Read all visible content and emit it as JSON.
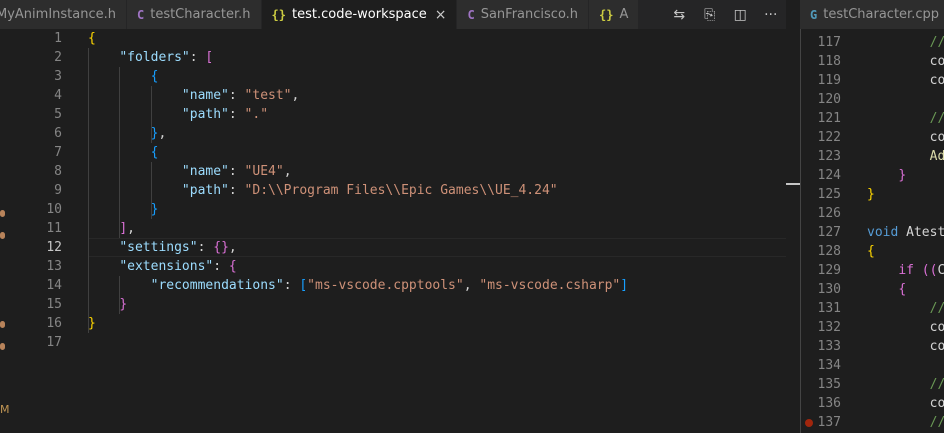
{
  "tabs_left": [
    {
      "icon": "c-header-icon",
      "glyph": "",
      "label": "MyAnimInstance.h",
      "active": false
    },
    {
      "icon": "c-header-icon",
      "glyph": "C",
      "label": "testCharacter.h",
      "active": false
    },
    {
      "icon": "json-icon",
      "glyph": "{}",
      "label": "test.code-workspace",
      "active": true
    },
    {
      "icon": "c-header-icon",
      "glyph": "C",
      "label": "SanFrancisco.h",
      "active": false
    },
    {
      "icon": "json-icon",
      "glyph": "{}",
      "label": "A",
      "active": false
    }
  ],
  "toolbar": {
    "compare_glyph": "⇆",
    "open_preview_glyph": "⎘",
    "split_glyph": "◫",
    "more_glyph": "···"
  },
  "tabs_right": [
    {
      "icon": "cpp-icon",
      "glyph": "G",
      "label": "testCharacter.cpp",
      "active": false
    }
  ],
  "left_editor": {
    "current_line": 12,
    "lines": [
      {
        "n": "1",
        "t": [
          [
            "br",
            "{"
          ]
        ]
      },
      {
        "n": "2",
        "t": [
          [
            "p",
            "    "
          ],
          [
            "k",
            "\"folders\""
          ],
          [
            "p",
            ": "
          ],
          [
            "bp",
            "["
          ]
        ]
      },
      {
        "n": "3",
        "t": [
          [
            "p",
            "        "
          ],
          [
            "bb",
            "{"
          ]
        ]
      },
      {
        "n": "4",
        "t": [
          [
            "p",
            "            "
          ],
          [
            "k",
            "\"name\""
          ],
          [
            "p",
            ": "
          ],
          [
            "s",
            "\"test\""
          ],
          [
            "p",
            ","
          ]
        ]
      },
      {
        "n": "5",
        "t": [
          [
            "p",
            "            "
          ],
          [
            "k",
            "\"path\""
          ],
          [
            "p",
            ": "
          ],
          [
            "s",
            "\".\""
          ]
        ]
      },
      {
        "n": "6",
        "t": [
          [
            "p",
            "        "
          ],
          [
            "bb",
            "}"
          ],
          [
            "p",
            ","
          ]
        ]
      },
      {
        "n": "7",
        "t": [
          [
            "p",
            "        "
          ],
          [
            "bb",
            "{"
          ]
        ]
      },
      {
        "n": "8",
        "t": [
          [
            "p",
            "            "
          ],
          [
            "k",
            "\"name\""
          ],
          [
            "p",
            ": "
          ],
          [
            "s",
            "\"UE4\""
          ],
          [
            "p",
            ","
          ]
        ]
      },
      {
        "n": "9",
        "t": [
          [
            "p",
            "            "
          ],
          [
            "k",
            "\"path\""
          ],
          [
            "p",
            ": "
          ],
          [
            "s",
            "\"D:\\\\Program Files\\\\Epic Games\\\\UE_4.24\""
          ]
        ]
      },
      {
        "n": "10",
        "t": [
          [
            "p",
            "        "
          ],
          [
            "bb",
            "}"
          ]
        ]
      },
      {
        "n": "11",
        "t": [
          [
            "p",
            "    "
          ],
          [
            "bp",
            "]"
          ],
          [
            "p",
            ","
          ]
        ]
      },
      {
        "n": "12",
        "t": [
          [
            "p",
            "    "
          ],
          [
            "k",
            "\"settings\""
          ],
          [
            "p",
            ": "
          ],
          [
            "bp",
            "{}"
          ],
          [
            "p",
            ","
          ]
        ]
      },
      {
        "n": "13",
        "t": [
          [
            "p",
            "    "
          ],
          [
            "k",
            "\"extensions\""
          ],
          [
            "p",
            ": "
          ],
          [
            "bp",
            "{"
          ]
        ]
      },
      {
        "n": "14",
        "t": [
          [
            "p",
            "        "
          ],
          [
            "k",
            "\"recommendations\""
          ],
          [
            "p",
            ": "
          ],
          [
            "bb",
            "["
          ],
          [
            "s",
            "\"ms-vscode.cpptools\""
          ],
          [
            "p",
            ", "
          ],
          [
            "s",
            "\"ms-vscode.csharp\""
          ],
          [
            "bb",
            "]"
          ]
        ]
      },
      {
        "n": "15",
        "t": [
          [
            "p",
            "    "
          ],
          [
            "bp",
            "}"
          ]
        ]
      },
      {
        "n": "16",
        "t": [
          [
            "br",
            "}"
          ]
        ]
      },
      {
        "n": "17",
        "t": []
      }
    ]
  },
  "right_editor": {
    "lines": [
      {
        "n": "117",
        "t": [
          [
            "p",
            "        "
          ],
          [
            "cm",
            "//"
          ]
        ]
      },
      {
        "n": "118",
        "t": [
          [
            "p",
            "        "
          ],
          [
            "p",
            "co"
          ]
        ]
      },
      {
        "n": "119",
        "t": [
          [
            "p",
            "        "
          ],
          [
            "p",
            "co"
          ]
        ]
      },
      {
        "n": "120",
        "t": []
      },
      {
        "n": "121",
        "t": [
          [
            "p",
            "        "
          ],
          [
            "cm",
            "//"
          ]
        ]
      },
      {
        "n": "122",
        "t": [
          [
            "p",
            "        "
          ],
          [
            "p",
            "co"
          ]
        ]
      },
      {
        "n": "123",
        "t": [
          [
            "p",
            "        "
          ],
          [
            "fn",
            "Ad"
          ]
        ]
      },
      {
        "n": "124",
        "t": [
          [
            "p",
            "    "
          ],
          [
            "bp",
            "}"
          ]
        ]
      },
      {
        "n": "125",
        "t": [
          [
            "br",
            "}"
          ]
        ]
      },
      {
        "n": "126",
        "t": []
      },
      {
        "n": "127",
        "t": [
          [
            "kw",
            "void"
          ],
          [
            "p",
            " "
          ],
          [
            "p",
            "Atest"
          ]
        ]
      },
      {
        "n": "128",
        "t": [
          [
            "br",
            "{"
          ]
        ]
      },
      {
        "n": "129",
        "t": [
          [
            "p",
            "    "
          ],
          [
            "bp",
            "if"
          ],
          [
            "p",
            " "
          ],
          [
            "bp",
            "(("
          ],
          [
            "p",
            "C"
          ]
        ]
      },
      {
        "n": "130",
        "t": [
          [
            "p",
            "    "
          ],
          [
            "bp",
            "{"
          ]
        ]
      },
      {
        "n": "131",
        "t": [
          [
            "p",
            "        "
          ],
          [
            "cm",
            "//"
          ]
        ]
      },
      {
        "n": "132",
        "t": [
          [
            "p",
            "        "
          ],
          [
            "p",
            "co"
          ]
        ]
      },
      {
        "n": "133",
        "t": [
          [
            "p",
            "        "
          ],
          [
            "p",
            "co"
          ]
        ]
      },
      {
        "n": "134",
        "t": []
      },
      {
        "n": "135",
        "t": [
          [
            "p",
            "        "
          ],
          [
            "cm",
            "//"
          ]
        ]
      },
      {
        "n": "136",
        "t": [
          [
            "p",
            "        "
          ],
          [
            "p",
            "co"
          ]
        ]
      },
      {
        "n": "137",
        "t": [
          [
            "p",
            "        "
          ],
          [
            "cm",
            "//"
          ]
        ],
        "breakpoint": true
      }
    ]
  },
  "activity_marks": [
    {
      "name": "gutter-mark-1"
    },
    {
      "name": "gutter-mark-2"
    },
    {
      "name": "gutter-mark-3"
    },
    {
      "name": "gutter-mark-4"
    },
    {
      "name": "gutter-mark-5"
    }
  ],
  "activity_letter": "M"
}
